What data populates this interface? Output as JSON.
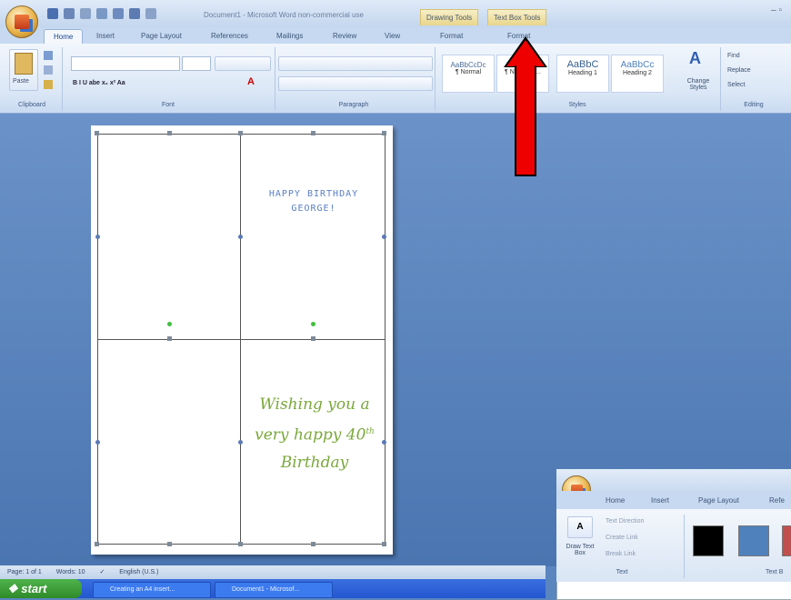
{
  "window": {
    "title": "Document1 - Microsoft Word non-commercial use",
    "context_tabs": [
      "Drawing Tools",
      "Text Box Tools"
    ]
  },
  "ribbon_tabs": [
    "Home",
    "Insert",
    "Page Layout",
    "References",
    "Mailings",
    "Review",
    "View",
    "Format",
    "Format"
  ],
  "ribbon": {
    "clipboard": {
      "paste_label": "Paste",
      "group": "Clipboard"
    },
    "font": {
      "group": "Font",
      "format_row": "B  I  U  abe  x₂  x²  Aa"
    },
    "paragraph": {
      "group": "Paragraph"
    },
    "styles": {
      "group": "Styles",
      "items": [
        {
          "preview": "AaBbCcDc",
          "name": "¶ Normal"
        },
        {
          "preview": "AaBbCcDc",
          "name": "¶ No Spaci..."
        },
        {
          "preview": "AaBbC",
          "name": "Heading 1"
        },
        {
          "preview": "AaBbCc",
          "name": "Heading 2"
        }
      ],
      "change_styles": "Change Styles"
    },
    "editing": {
      "group": "Editing",
      "find": "Find",
      "replace": "Replace",
      "select": "Select"
    }
  },
  "document": {
    "greeting_line1": "HAPPY BIRTHDAY",
    "greeting_line2": "GEORGE!",
    "wish_line1": "Wishing you a",
    "wish_line2": "very happy 40",
    "wish_sup": "th",
    "wish_line3": "Birthday"
  },
  "status_bar": {
    "page": "Page: 1 of 1",
    "words": "Words: 10",
    "language": "English (U.S.)"
  },
  "taskbar": {
    "start_label": "start",
    "items": [
      "Creating an A4 insert...",
      "Document1 - Microsof..."
    ]
  },
  "inset": {
    "tabs": [
      "Home",
      "Insert",
      "Page Layout",
      "Refe"
    ],
    "draw_text_box": "Draw Text Box",
    "text_direction": "Text Direction",
    "create_link": "Create Link",
    "break_link": "Break Link",
    "group_text": "Text",
    "group_textbox_styles": "Text B",
    "swatch_colors": [
      "#000000",
      "#4f81bd",
      "#c0504d"
    ]
  }
}
